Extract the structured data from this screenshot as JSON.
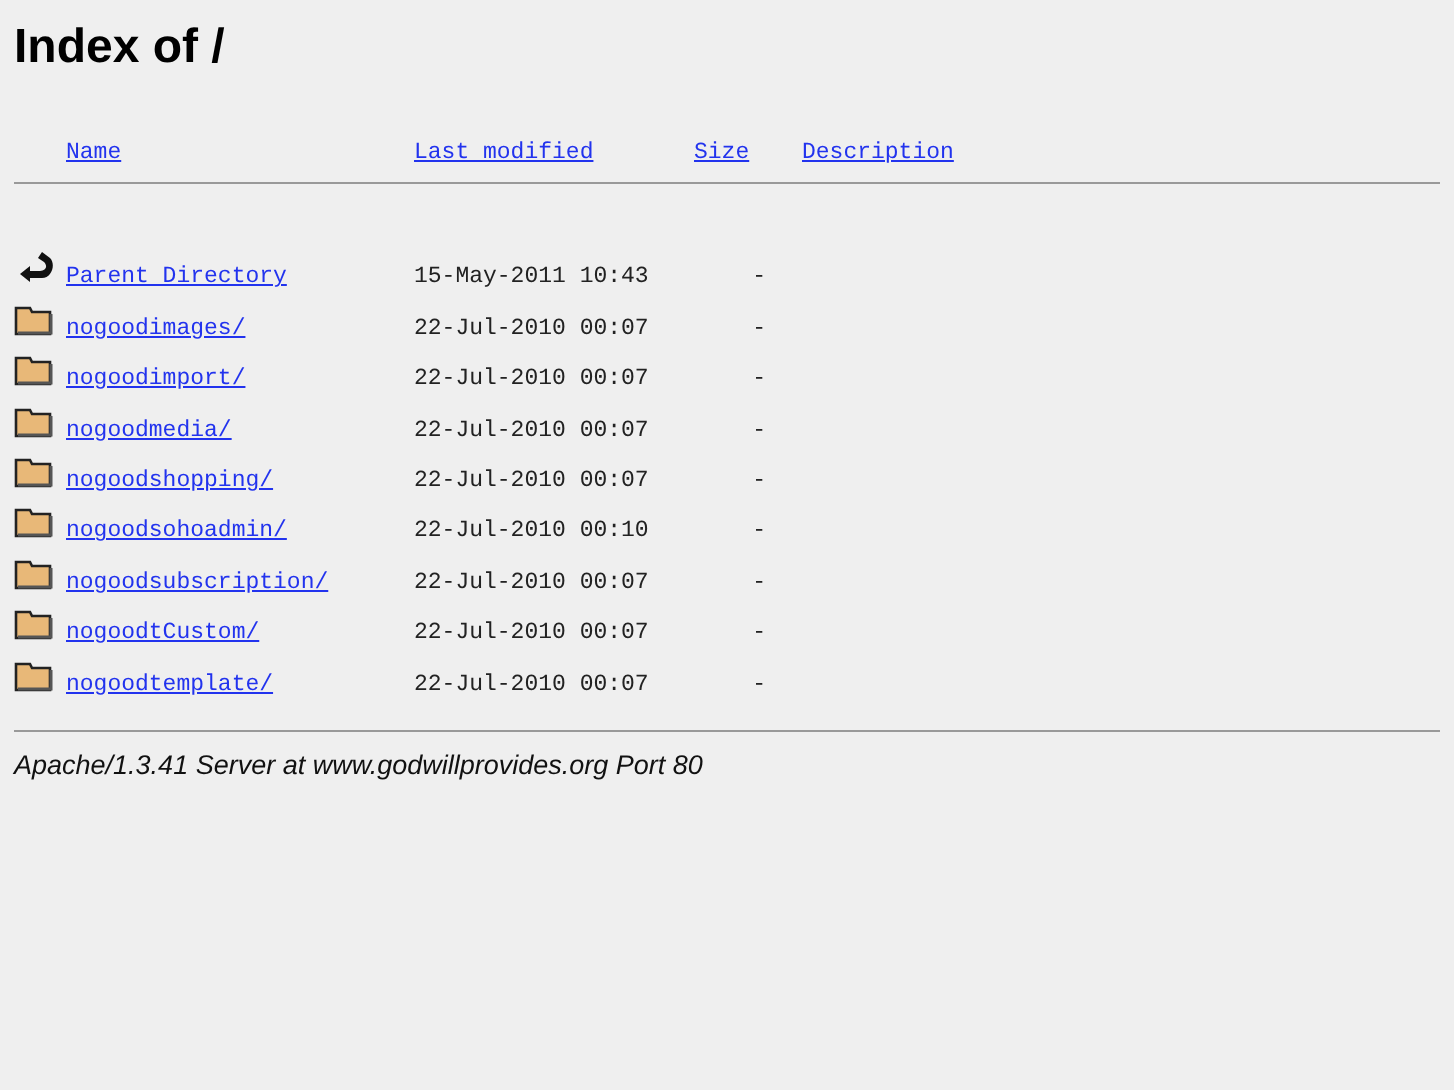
{
  "title": "Index of /",
  "columns": [
    {
      "label": "Name"
    },
    {
      "label": "Last modified"
    },
    {
      "label": "Size"
    },
    {
      "label": "Description"
    }
  ],
  "rows": [
    {
      "kind": "parent",
      "name": "Parent Directory",
      "modified": "15-May-2011 10:43",
      "size": "-"
    },
    {
      "kind": "folder",
      "name": "nogoodimages/",
      "modified": "22-Jul-2010 00:07",
      "size": "-"
    },
    {
      "kind": "folder",
      "name": "nogoodimport/",
      "modified": "22-Jul-2010 00:07",
      "size": "-"
    },
    {
      "kind": "folder",
      "name": "nogoodmedia/",
      "modified": "22-Jul-2010 00:07",
      "size": "-"
    },
    {
      "kind": "folder",
      "name": "nogoodshopping/",
      "modified": "22-Jul-2010 00:07",
      "size": "-"
    },
    {
      "kind": "folder",
      "name": "nogoodsohoadmin/",
      "modified": "22-Jul-2010 00:10",
      "size": "-"
    },
    {
      "kind": "folder",
      "name": "nogoodsubscription/",
      "modified": "22-Jul-2010 00:07",
      "size": "-"
    },
    {
      "kind": "folder",
      "name": "nogoodtCustom/",
      "modified": "22-Jul-2010 00:07",
      "size": "-"
    },
    {
      "kind": "folder",
      "name": "nogoodtemplate/",
      "modified": "22-Jul-2010 00:07",
      "size": "-"
    }
  ],
  "footer": "Apache/1.3.41 Server at www.godwillprovides.org Port 80"
}
